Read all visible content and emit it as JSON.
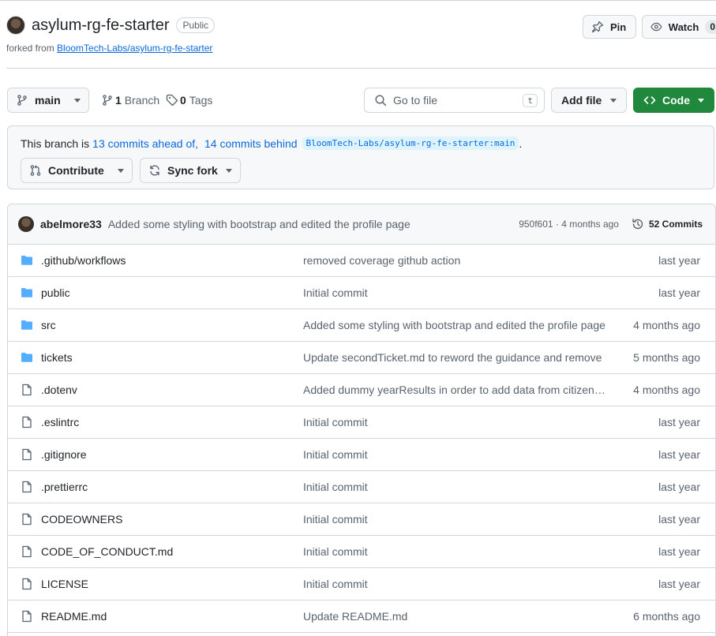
{
  "repo": {
    "name": "asylum-rg-fe-starter",
    "visibility": "Public",
    "forked_prefix": "forked from ",
    "forked_from": "BloomTech-Labs/asylum-rg-fe-starter"
  },
  "actions": {
    "pin_label": "Pin",
    "watch_label": "Watch",
    "watch_count": "0"
  },
  "toolbar": {
    "branch": "main",
    "branch_count": "1",
    "branch_label": "Branch",
    "tag_count": "0",
    "tag_label": "Tags",
    "goto_placeholder": "Go to file",
    "goto_shortcut": "t",
    "add_file_label": "Add file",
    "code_label": "Code"
  },
  "fork_banner": {
    "prefix": "This branch is",
    "ahead": "13 commits ahead of,",
    "behind": "14 commits behind",
    "upstream": "BloomTech-Labs/asylum-rg-fe-starter:main",
    "suffix": ".",
    "contribute_label": "Contribute",
    "sync_label": "Sync fork"
  },
  "latest_commit": {
    "author": "abelmore33",
    "message": "Added some styling with bootstrap and edited the profile page",
    "meta": "950f601 · 4 months ago",
    "commits_label": "52 Commits"
  },
  "files": [
    {
      "type": "folder",
      "name": ".github/workflows",
      "message": "removed coverage github action",
      "age": "last year"
    },
    {
      "type": "folder",
      "name": "public",
      "message": "Initial commit",
      "age": "last year"
    },
    {
      "type": "folder",
      "name": "src",
      "message": "Added some styling with bootstrap and edited the profile page",
      "age": "4 months ago"
    },
    {
      "type": "folder",
      "name": "tickets",
      "message": "Update secondTicket.md to reword the guidance and remove",
      "age": "5 months ago"
    },
    {
      "type": "file",
      "name": ".dotenv",
      "message": "Added dummy yearResults in order to add data from citizenship",
      "age": "4 months ago"
    },
    {
      "type": "file",
      "name": ".eslintrc",
      "message": "Initial commit",
      "age": "last year"
    },
    {
      "type": "file",
      "name": ".gitignore",
      "message": "Initial commit",
      "age": "last year"
    },
    {
      "type": "file",
      "name": ".prettierrc",
      "message": "Initial commit",
      "age": "last year"
    },
    {
      "type": "file",
      "name": "CODEOWNERS",
      "message": "Initial commit",
      "age": "last year"
    },
    {
      "type": "file",
      "name": "CODE_OF_CONDUCT.md",
      "message": "Initial commit",
      "age": "last year"
    },
    {
      "type": "file",
      "name": "LICENSE",
      "message": "Initial commit",
      "age": "last year"
    },
    {
      "type": "file",
      "name": "README.md",
      "message": "Update README.md",
      "age": "6 months ago"
    }
  ],
  "colors": {
    "accent_link": "#0969da",
    "code_button": "#1f883d",
    "folder_icon": "#54aeff"
  }
}
